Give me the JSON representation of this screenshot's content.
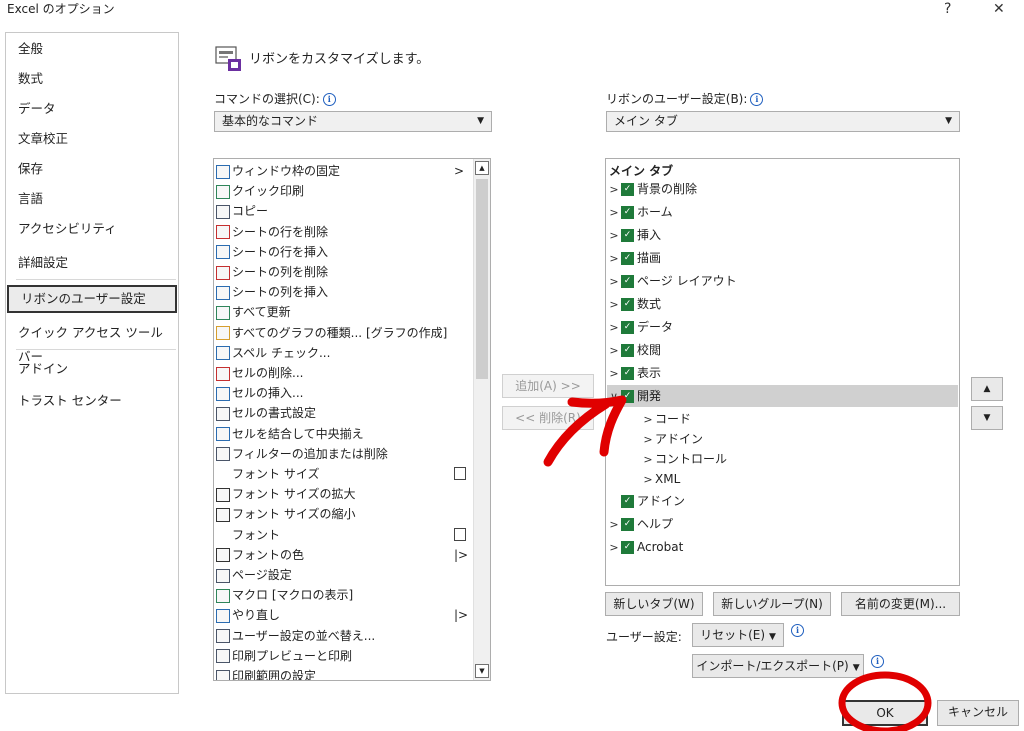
{
  "window": {
    "title": "Excel のオプション",
    "help_label": "?",
    "close_label": "✕"
  },
  "sidebar": {
    "items": [
      {
        "label": "全般"
      },
      {
        "label": "数式"
      },
      {
        "label": "データ"
      },
      {
        "label": "文章校正"
      },
      {
        "label": "保存"
      },
      {
        "label": "言語"
      },
      {
        "label": "アクセシビリティ"
      },
      {
        "label": "詳細設定"
      },
      {
        "label": "リボンのユーザー設定",
        "selected": true
      },
      {
        "label": "クイック アクセス ツール バー"
      },
      {
        "label": "アドイン"
      },
      {
        "label": "トラスト センター"
      }
    ]
  },
  "header": {
    "text": "リボンをカスタマイズします。"
  },
  "commands": {
    "label": "コマンドの選択(C):",
    "selected": "基本的なコマンド",
    "items": [
      {
        "label": "ウィンドウ枠の固定",
        "icon": "freeze-panes-icon",
        "suffix": ">"
      },
      {
        "label": "クイック印刷",
        "icon": "quick-print-icon"
      },
      {
        "label": "コピー",
        "icon": "copy-icon"
      },
      {
        "label": "シートの行を削除",
        "icon": "delete-rows-icon"
      },
      {
        "label": "シートの行を挿入",
        "icon": "insert-rows-icon"
      },
      {
        "label": "シートの列を削除",
        "icon": "delete-columns-icon"
      },
      {
        "label": "シートの列を挿入",
        "icon": "insert-columns-icon"
      },
      {
        "label": "すべて更新",
        "icon": "refresh-all-icon"
      },
      {
        "label": "すべてのグラフの種類... [グラフの作成]",
        "icon": "chart-icon"
      },
      {
        "label": "スペル チェック...",
        "icon": "spell-check-icon"
      },
      {
        "label": "セルの削除...",
        "icon": "delete-cells-icon"
      },
      {
        "label": "セルの挿入...",
        "icon": "insert-cells-icon"
      },
      {
        "label": "セルの書式設定",
        "icon": "format-cells-icon"
      },
      {
        "label": "セルを結合して中央揃え",
        "icon": "merge-center-icon"
      },
      {
        "label": "フィルターの追加または削除",
        "icon": "filter-icon"
      },
      {
        "label": "フォント サイズ",
        "icon": "",
        "suffix_icon": "textbox-icon"
      },
      {
        "label": "フォント サイズの拡大",
        "icon": "font-grow-icon"
      },
      {
        "label": "フォント サイズの縮小",
        "icon": "font-shrink-icon"
      },
      {
        "label": "フォント",
        "icon": "",
        "suffix_icon": "textbox-icon"
      },
      {
        "label": "フォントの色",
        "icon": "font-color-icon",
        "suffix": "|>"
      },
      {
        "label": "ページ設定",
        "icon": "page-setup-icon"
      },
      {
        "label": "マクロ [マクロの表示]",
        "icon": "macro-play-icon"
      },
      {
        "label": "やり直し",
        "icon": "redo-icon",
        "suffix": "|>"
      },
      {
        "label": "ユーザー設定の並べ替え...",
        "icon": "custom-sort-icon"
      },
      {
        "label": "印刷プレビューと印刷",
        "icon": "print-preview-icon"
      },
      {
        "label": "印刷範囲の設定",
        "icon": "print-area-icon"
      }
    ]
  },
  "ribbon": {
    "label": "リボンのユーザー設定(B):",
    "selected": "メイン タブ",
    "root": "メイン タブ",
    "tabs": [
      {
        "label": "背景の削除",
        "expanded": false
      },
      {
        "label": "ホーム",
        "expanded": false
      },
      {
        "label": "挿入",
        "expanded": false
      },
      {
        "label": "描画",
        "expanded": false
      },
      {
        "label": "ページ レイアウト",
        "expanded": false
      },
      {
        "label": "数式",
        "expanded": false
      },
      {
        "label": "データ",
        "expanded": false
      },
      {
        "label": "校閲",
        "expanded": false
      },
      {
        "label": "表示",
        "expanded": false
      },
      {
        "label": "開発",
        "expanded": true
      }
    ],
    "dev_groups": [
      {
        "label": "コード"
      },
      {
        "label": "アドイン"
      },
      {
        "label": "コントロール"
      },
      {
        "label": "XML"
      }
    ],
    "tabs_after": [
      {
        "label": "アドイン",
        "has_chevron": false
      },
      {
        "label": "ヘルプ",
        "has_chevron": true
      },
      {
        "label": "Acrobat",
        "has_chevron": true
      }
    ]
  },
  "buttons": {
    "add": "追加(A) >>",
    "remove": "<< 削除(R)",
    "new_tab": "新しいタブ(W)",
    "new_group": "新しいグループ(N)",
    "rename": "名前の変更(M)...",
    "user_settings_label": "ユーザー設定:",
    "reset": "リセット(E)",
    "import_export": "インポート/エクスポート(P)",
    "ok": "OK",
    "cancel": "キャンセル",
    "move_up": "▲",
    "move_down": "▼"
  },
  "colors": {
    "checkbox": "#1f7a3a",
    "annotation": "#e00000",
    "highlight": "#d0d0d0"
  }
}
